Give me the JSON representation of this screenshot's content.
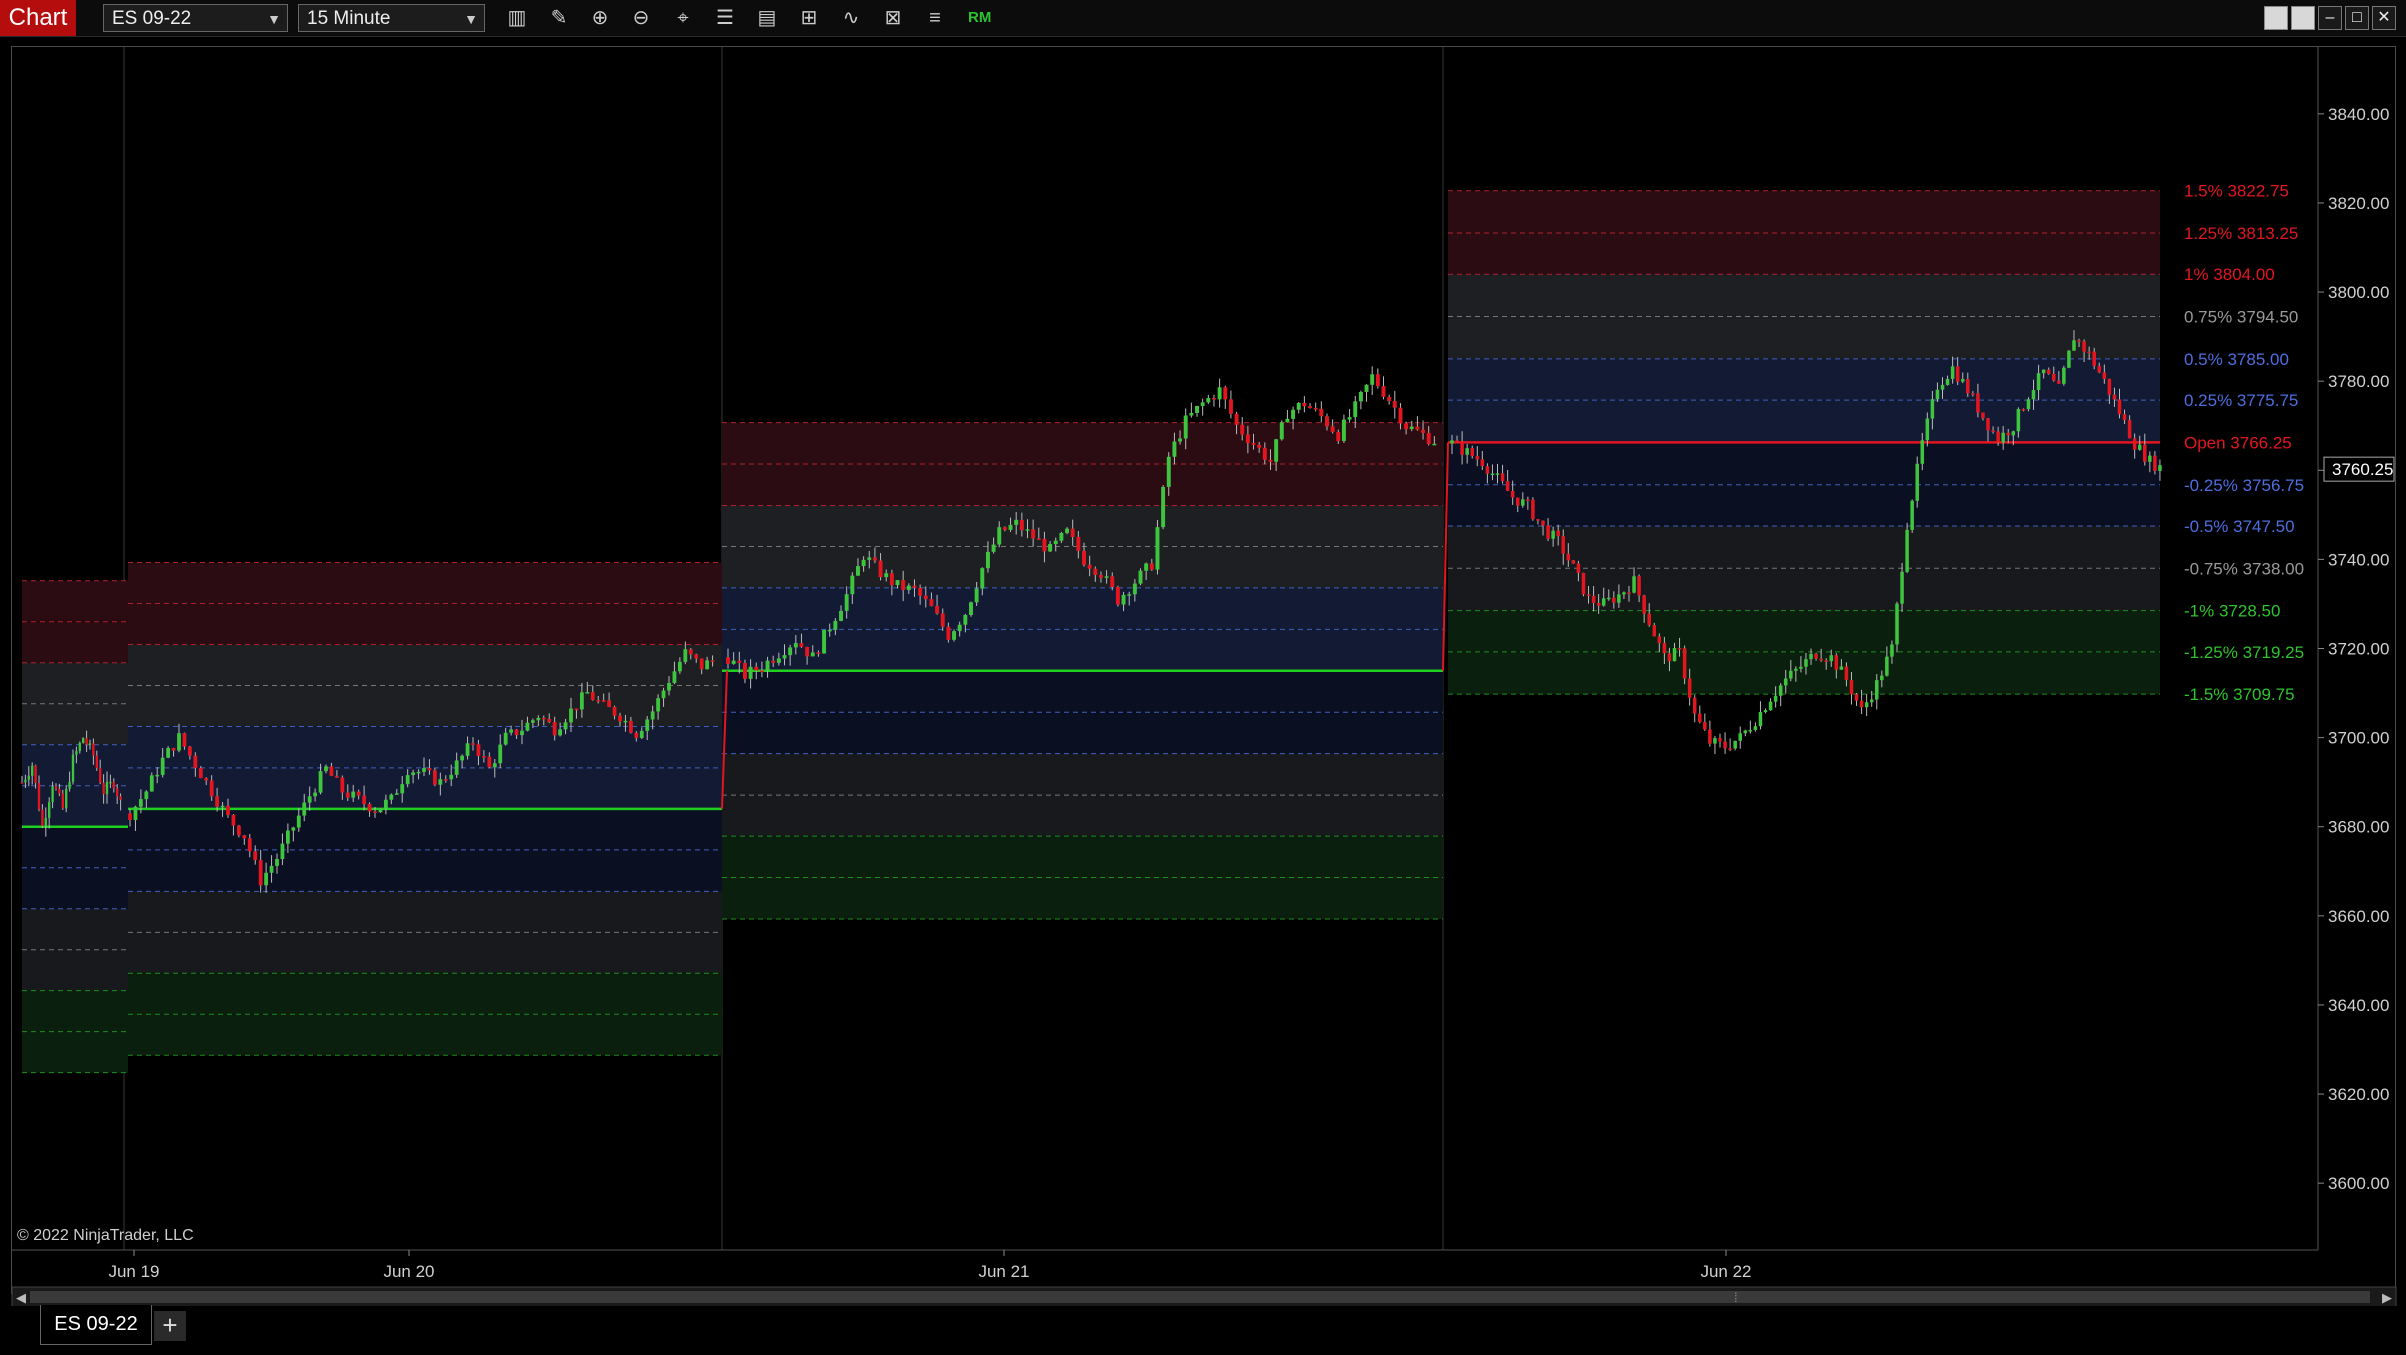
{
  "window": {
    "app_label": "Chart",
    "instrument": "ES 09-22",
    "interval": "15 Minute",
    "rm_label": "RM"
  },
  "toolbar": {
    "icons": [
      "bar-type-icon",
      "pencil-icon",
      "zoom-in-icon",
      "zoom-out-icon",
      "crosshair-icon",
      "properties-icon",
      "templates-icon",
      "indicators-icon",
      "strategies-icon",
      "chart-trader-icon",
      "data-box-icon"
    ]
  },
  "chart_data": {
    "type": "candlestick",
    "copyright": "© 2022 NinjaTrader, LLC",
    "ylim": [
      3585,
      3855
    ],
    "y_ticks": [
      "3840.00",
      "3820.00",
      "3800.00",
      "3780.00",
      "3760.00",
      "3740.00",
      "3720.00",
      "3700.00",
      "3680.00",
      "3660.00",
      "3640.00",
      "3620.00",
      "3600.00"
    ],
    "x_labels": [
      "Jun 19",
      "Jun 20",
      "Jun 21",
      "Jun 22"
    ],
    "current_price": "3760.25",
    "colors": {
      "up": "#3ec43e",
      "down": "#e3161f",
      "open_line": "#e3161f",
      "level_line": "#20d020"
    },
    "sessions": [
      {
        "open": 3680,
        "levels": [
          3735.2,
          3726,
          3716.8,
          3707.6,
          3698.4,
          3689.2,
          3670.8,
          3661.6,
          3652.4,
          3643.2,
          3634,
          3624.8
        ],
        "line": 3680,
        "line_color": "green"
      },
      {
        "open": 3684,
        "levels": [
          3739.3,
          3730.1,
          3720.9,
          3711.7,
          3702.5,
          3693.2,
          3674.8,
          3665.5,
          3656.3,
          3647.1,
          3637.9,
          3628.7
        ],
        "line": 3684,
        "line_color": "green"
      },
      {
        "open": 3715,
        "levels": [
          3770.7,
          3761.4,
          3752.1,
          3742.9,
          3733.6,
          3724.3,
          3705.7,
          3696.4,
          3687.1,
          3677.9,
          3668.6,
          3659.3
        ],
        "line": 3715,
        "line_color": "green"
      },
      {
        "open": 3766.25,
        "levels": [
          3822.75,
          3813.25,
          3804.0,
          3794.5,
          3785.0,
          3775.75,
          3756.75,
          3747.5,
          3738.0,
          3728.5,
          3719.25,
          3709.75
        ],
        "line": 3766.25,
        "line_color": "red"
      }
    ],
    "level_labels": [
      {
        "text": "1.5% 3822.75",
        "value": 3822.75,
        "color": "#e3161f"
      },
      {
        "text": "1.25% 3813.25",
        "value": 3813.25,
        "color": "#e3161f"
      },
      {
        "text": "1% 3804.00",
        "value": 3804.0,
        "color": "#e3161f"
      },
      {
        "text": "0.75% 3794.50",
        "value": 3794.5,
        "color": "#9a9a9a"
      },
      {
        "text": "0.5% 3785.00",
        "value": 3785.0,
        "color": "#4d6fe0"
      },
      {
        "text": "0.25% 3775.75",
        "value": 3775.75,
        "color": "#4d6fe0"
      },
      {
        "text": "Open 3766.25",
        "value": 3766.25,
        "color": "#e3161f"
      },
      {
        "text": "-0.25% 3756.75",
        "value": 3756.75,
        "color": "#4d6fe0"
      },
      {
        "text": "-0.5% 3747.50",
        "value": 3747.5,
        "color": "#4d6fe0"
      },
      {
        "text": "-0.75% 3738.00",
        "value": 3738.0,
        "color": "#9a9a9a"
      },
      {
        "text": "-1% 3728.50",
        "value": 3728.5,
        "color": "#2ec42e"
      },
      {
        "text": "-1.25% 3719.25",
        "value": 3719.25,
        "color": "#2ec42e"
      },
      {
        "text": "-1.5% 3709.75",
        "value": 3709.75,
        "color": "#2ec42e"
      }
    ],
    "price_path": [
      [
        3690,
        3694,
        3680,
        3690,
        3684,
        3695,
        3700,
        3696,
        3688,
        3690,
        3683
      ],
      [
        3683,
        3688,
        3695,
        3700,
        3694,
        3688,
        3682,
        3678,
        3668,
        3673,
        3680,
        3687,
        3693,
        3688,
        3686,
        3684,
        3686,
        3693,
        3692,
        3690,
        3694,
        3699,
        3693,
        3700,
        3702,
        3705,
        3702,
        3706,
        3710,
        3707,
        3705,
        3701,
        3706,
        3713,
        3719,
        3716,
        3718
      ],
      [
        3718,
        3714,
        3716,
        3719,
        3722,
        3718,
        3725,
        3732,
        3741,
        3737,
        3734,
        3733,
        3729,
        3723,
        3728,
        3738,
        3746,
        3748,
        3745,
        3742,
        3746,
        3740,
        3737,
        3731,
        3735,
        3739,
        3763,
        3771,
        3775,
        3778,
        3770,
        3766,
        3762,
        3773,
        3775,
        3772,
        3768,
        3774,
        3781,
        3776,
        3770,
        3768,
        3766
      ],
      [
        3766,
        3764,
        3762,
        3758,
        3754,
        3752,
        3747,
        3744,
        3738,
        3731,
        3730,
        3732,
        3735,
        3726,
        3718,
        3719,
        3705,
        3699,
        3698,
        3700,
        3704,
        3709,
        3713,
        3716,
        3719,
        3718,
        3713,
        3706,
        3712,
        3720,
        3748,
        3766,
        3779,
        3783,
        3778,
        3772,
        3767,
        3770,
        3777,
        3782,
        3778,
        3790,
        3786,
        3780,
        3773,
        3766,
        3762,
        3760
      ]
    ]
  },
  "tabs": [
    {
      "label": "ES 09-22"
    }
  ],
  "add_tab_label": "+"
}
